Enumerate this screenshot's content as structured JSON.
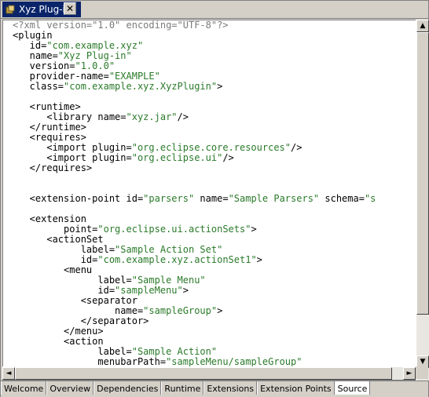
{
  "editor_tab": {
    "title": "Xyz Plug-in",
    "icon": "plugin-icon",
    "close_label": "✕"
  },
  "code_lines": [
    [
      {
        "t": "pi",
        "s": "<?xml version=\"1.0\" encoding=\"UTF-8\"?>"
      }
    ],
    [
      {
        "t": "tag",
        "s": "<plugin"
      }
    ],
    [
      {
        "t": "tag",
        "s": "   id="
      },
      {
        "t": "val",
        "s": "\"com.example.xyz\""
      }
    ],
    [
      {
        "t": "tag",
        "s": "   name="
      },
      {
        "t": "val",
        "s": "\"Xyz Plug-in\""
      }
    ],
    [
      {
        "t": "tag",
        "s": "   version="
      },
      {
        "t": "val",
        "s": "\"1.0.0\""
      }
    ],
    [
      {
        "t": "tag",
        "s": "   provider-name="
      },
      {
        "t": "val",
        "s": "\"EXAMPLE\""
      }
    ],
    [
      {
        "t": "tag",
        "s": "   class="
      },
      {
        "t": "val",
        "s": "\"com.example.xyz.XyzPlugin\""
      },
      {
        "t": "tag",
        "s": ">"
      }
    ],
    [],
    [
      {
        "t": "tag",
        "s": "   <runtime>"
      }
    ],
    [
      {
        "t": "tag",
        "s": "      <library name="
      },
      {
        "t": "val",
        "s": "\"xyz.jar\""
      },
      {
        "t": "tag",
        "s": "/>"
      }
    ],
    [
      {
        "t": "tag",
        "s": "   </runtime>"
      }
    ],
    [
      {
        "t": "tag",
        "s": "   <requires>"
      }
    ],
    [
      {
        "t": "tag",
        "s": "      <import plugin="
      },
      {
        "t": "val",
        "s": "\"org.eclipse.core.resources\""
      },
      {
        "t": "tag",
        "s": "/>"
      }
    ],
    [
      {
        "t": "tag",
        "s": "      <import plugin="
      },
      {
        "t": "val",
        "s": "\"org.eclipse.ui\""
      },
      {
        "t": "tag",
        "s": "/>"
      }
    ],
    [
      {
        "t": "tag",
        "s": "   </requires>"
      }
    ],
    [],
    [],
    [
      {
        "t": "tag",
        "s": "   <extension-point id="
      },
      {
        "t": "val",
        "s": "\"parsers\""
      },
      {
        "t": "tag",
        "s": " name="
      },
      {
        "t": "val",
        "s": "\"Sample Parsers\""
      },
      {
        "t": "tag",
        "s": " schema="
      },
      {
        "t": "val",
        "s": "\"s"
      }
    ],
    [],
    [
      {
        "t": "tag",
        "s": "   <extension"
      }
    ],
    [
      {
        "t": "tag",
        "s": "         point="
      },
      {
        "t": "val",
        "s": "\"org.eclipse.ui.actionSets\""
      },
      {
        "t": "tag",
        "s": ">"
      }
    ],
    [
      {
        "t": "tag",
        "s": "      <actionSet"
      }
    ],
    [
      {
        "t": "tag",
        "s": "            label="
      },
      {
        "t": "val",
        "s": "\"Sample Action Set\""
      }
    ],
    [
      {
        "t": "tag",
        "s": "            id="
      },
      {
        "t": "val",
        "s": "\"com.example.xyz.actionSet1\""
      },
      {
        "t": "tag",
        "s": ">"
      }
    ],
    [
      {
        "t": "tag",
        "s": "         <menu"
      }
    ],
    [
      {
        "t": "tag",
        "s": "               label="
      },
      {
        "t": "val",
        "s": "\"Sample Menu\""
      }
    ],
    [
      {
        "t": "tag",
        "s": "               id="
      },
      {
        "t": "val",
        "s": "\"sampleMenu\""
      },
      {
        "t": "tag",
        "s": ">"
      }
    ],
    [
      {
        "t": "tag",
        "s": "            <separator"
      }
    ],
    [
      {
        "t": "tag",
        "s": "                  name="
      },
      {
        "t": "val",
        "s": "\"sampleGroup\""
      },
      {
        "t": "tag",
        "s": ">"
      }
    ],
    [
      {
        "t": "tag",
        "s": "            </separator>"
      }
    ],
    [
      {
        "t": "tag",
        "s": "         </menu>"
      }
    ],
    [
      {
        "t": "tag",
        "s": "         <action"
      }
    ],
    [
      {
        "t": "tag",
        "s": "               label="
      },
      {
        "t": "val",
        "s": "\"Sample Action\""
      }
    ],
    [
      {
        "t": "tag",
        "s": "               menubarPath="
      },
      {
        "t": "val",
        "s": "\"sampleMenu/sampleGroup\""
      }
    ]
  ],
  "bottom_tabs": [
    {
      "label": "Welcome",
      "selected": false
    },
    {
      "label": "Overview",
      "selected": false
    },
    {
      "label": "Dependencies",
      "selected": false
    },
    {
      "label": "Runtime",
      "selected": false
    },
    {
      "label": "Extensions",
      "selected": false
    },
    {
      "label": "Extension Points",
      "selected": false
    },
    {
      "label": "Source",
      "selected": true
    }
  ],
  "scroll": {
    "up": "▲",
    "down": "▼",
    "left": "◄",
    "right": "►"
  }
}
